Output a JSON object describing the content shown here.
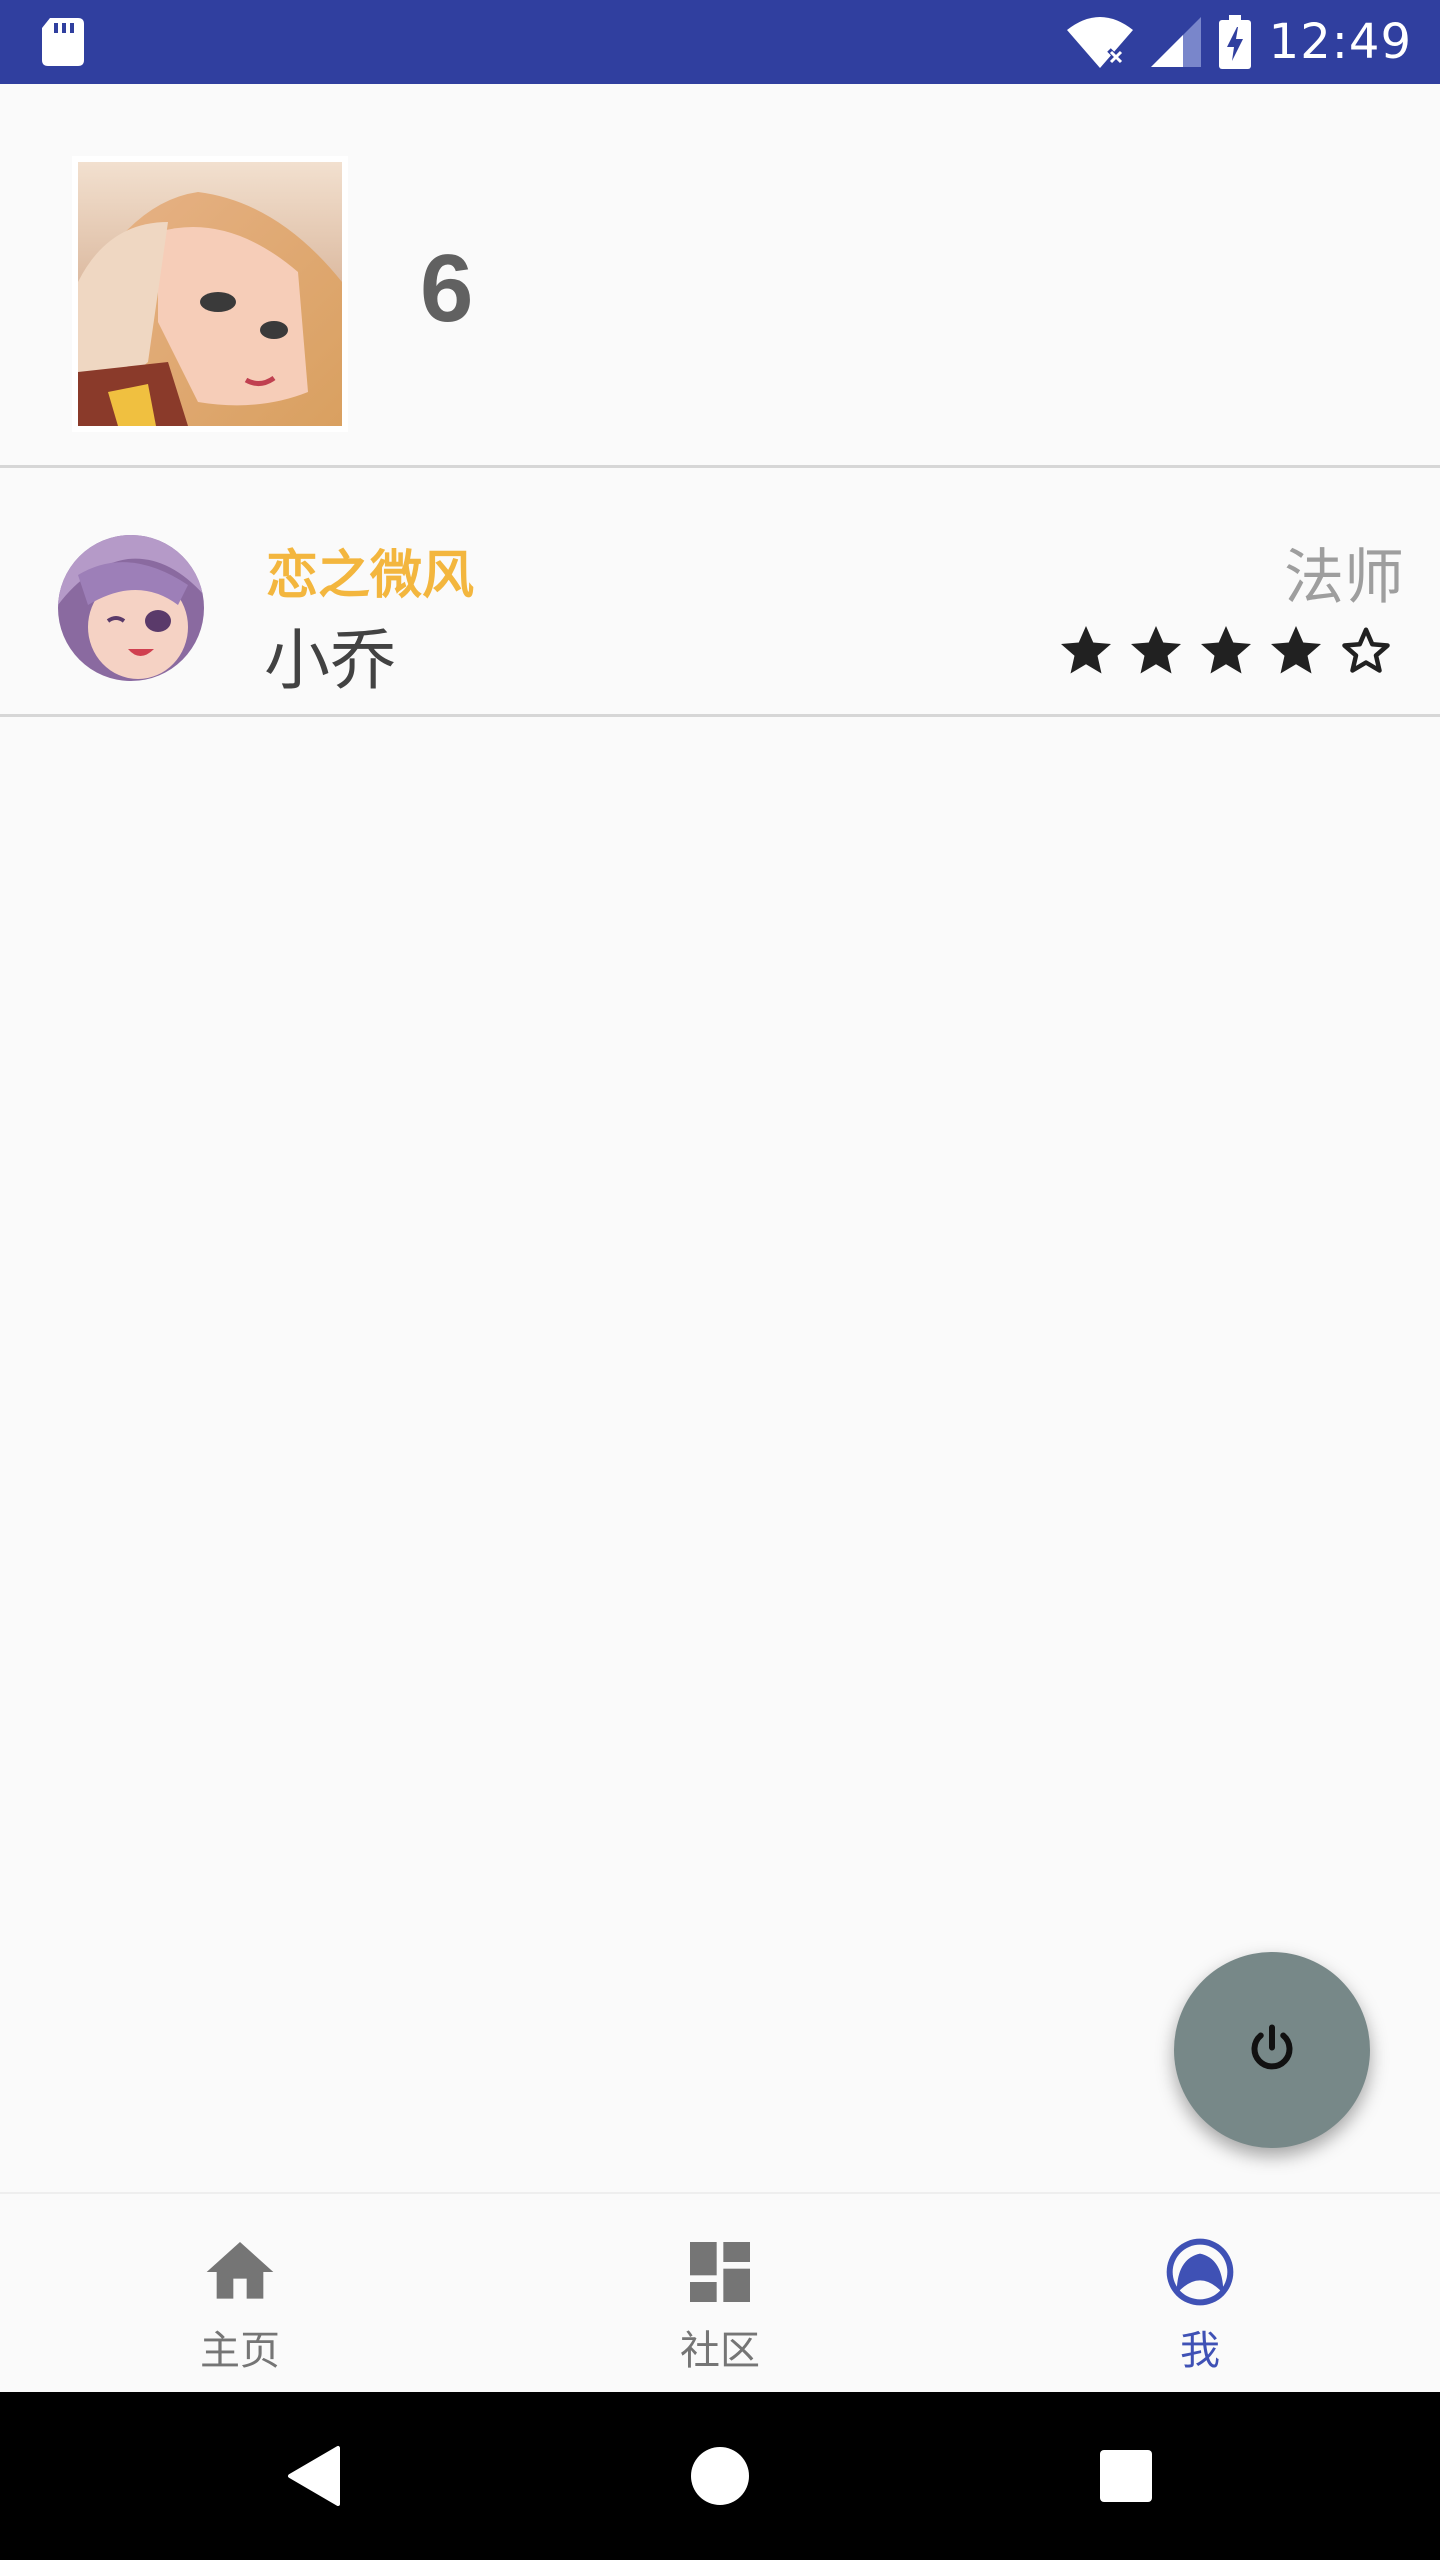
{
  "status_bar": {
    "time": "12:49",
    "icons": [
      "sd-card-icon",
      "wifi-icon",
      "signal-icon",
      "battery-charging-icon"
    ],
    "background": "#303f9f"
  },
  "profile": {
    "level": "6",
    "avatar": "anime-girl-avatar"
  },
  "hero": {
    "name": "恋之微风",
    "title": "小乔",
    "role": "法师",
    "rating": 4,
    "rating_max": 5,
    "name_color": "#f3b63e"
  },
  "fab": {
    "icon": "power-icon",
    "color": "#778888"
  },
  "bottom_nav": {
    "items": [
      {
        "label": "主页",
        "icon": "home-icon",
        "active": false
      },
      {
        "label": "社区",
        "icon": "dashboard-icon",
        "active": false
      },
      {
        "label": "我",
        "icon": "profile-icon",
        "active": true
      }
    ],
    "active_color": "#3f51b5",
    "inactive_color": "#757575"
  },
  "system_nav": {
    "buttons": [
      "back-icon",
      "home-circle-icon",
      "recents-icon"
    ]
  }
}
